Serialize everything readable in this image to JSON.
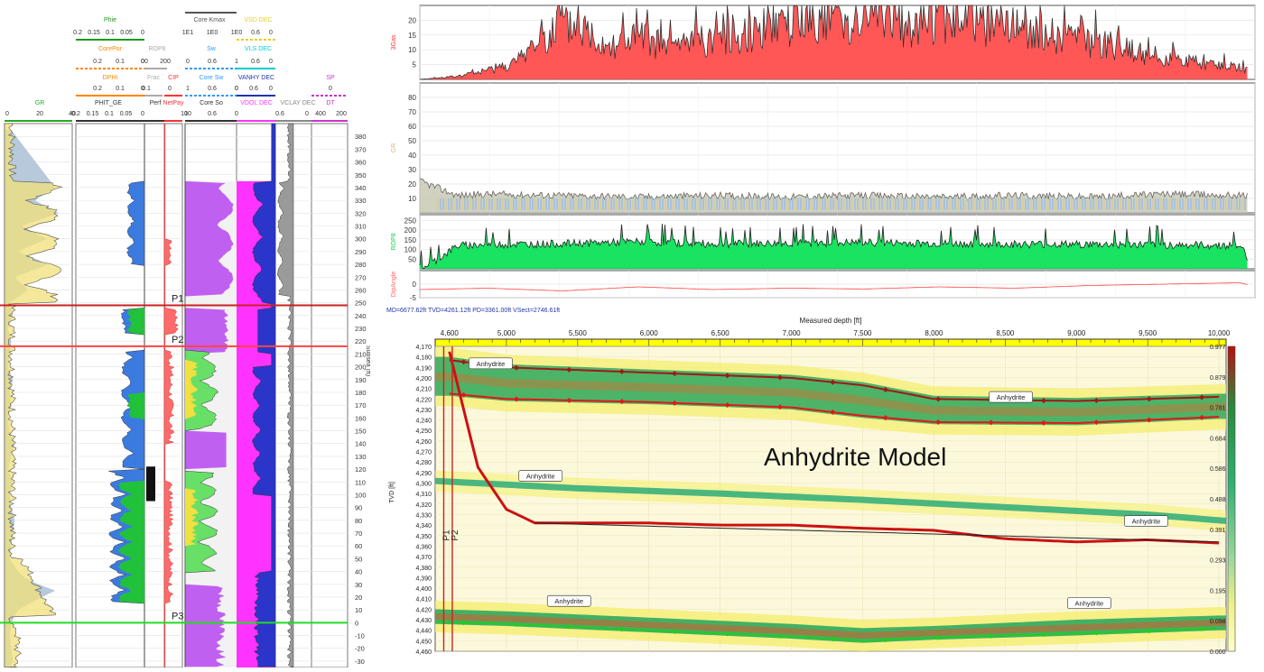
{
  "left_log": {
    "headers": {
      "phie": {
        "name": "Phie",
        "ticks": [
          "0.2",
          "0.15",
          "0.1",
          "0.05",
          "0"
        ],
        "color": "#1a9a1a"
      },
      "core_kmax": {
        "name": "Core Kmax",
        "ticks": [
          "1E1",
          "1E0",
          "1E0"
        ],
        "color": "#555555"
      },
      "vsd_dec": {
        "name": "VSD DEC",
        "ticks": [
          "0.6",
          "0"
        ],
        "color": "#e6d020"
      },
      "corepor": {
        "name": "CorePor",
        "ticks": [
          "0.2",
          "0.1",
          "0"
        ],
        "color": "#ff8800"
      },
      "rop": {
        "name": "ROP8",
        "ticks": [
          "00",
          "200"
        ],
        "color": "#aaaaaa"
      },
      "sw": {
        "name": "Sw",
        "ticks": [
          "0",
          "0.6",
          "1"
        ],
        "color": "#3399ff"
      },
      "vls_dec": {
        "name": "VLS DEC",
        "ticks": [
          "0.6",
          "0"
        ],
        "color": "#00cccc"
      },
      "dphi": {
        "name": "DPHI",
        "ticks": [
          "0.2",
          "0.1",
          "0"
        ],
        "color": "#ff8800"
      },
      "frac": {
        "name": "Frac",
        "ticks": [
          "0.1"
        ],
        "color": "#aaaaaa"
      },
      "cip": {
        "name": "CIP",
        "ticks": [
          "0"
        ],
        "color": "#ff3333"
      },
      "core_sw": {
        "name": "Core Sw",
        "ticks": [
          "1",
          "0.6",
          "0"
        ],
        "color": "#3399ff"
      },
      "vanhy_dec": {
        "name": "VANHY DEC",
        "ticks": [
          "0",
          "0.6",
          "0"
        ],
        "color": "#2233aa"
      },
      "sp": {
        "name": "SP",
        "ticks": [
          "0"
        ],
        "color": "#cc33cc"
      },
      "gr": {
        "name": "GR",
        "ticks": [
          "0",
          "20",
          "40"
        ],
        "color": "#22aa22"
      },
      "phit": {
        "name": "PHIT_GE",
        "ticks": [
          "0.2",
          "0.15",
          "0.1",
          "0.05",
          "0"
        ],
        "color": "#333333"
      },
      "perf": {
        "name": "Perf",
        "ticks": [],
        "color": "#333333"
      },
      "netpay": {
        "name": "NetPay",
        "ticks": [
          "10"
        ],
        "color": "#ff3333"
      },
      "core_so": {
        "name": "Core So",
        "ticks": [
          "10",
          "0.6",
          "0"
        ],
        "color": "#333333"
      },
      "vdol": {
        "name": "VDOL DEC",
        "color": "#ff33ff"
      },
      "vclay": {
        "name": "VCLAY DEC",
        "ticks": [
          "0.6",
          "0"
        ],
        "color": "#888888"
      },
      "dt": {
        "name": "DT",
        "ticks": [
          "400",
          "200"
        ],
        "color": "#cc33cc"
      }
    },
    "depth_axis_label": "Subsea (ft)",
    "markers": [
      {
        "label": "P1",
        "depth": 248,
        "color": "#cc2222"
      },
      {
        "label": "P2",
        "depth": 216,
        "color": "#ff4444"
      },
      {
        "label": "P3",
        "depth": 0,
        "color": "#22dd22"
      }
    ]
  },
  "chart_data": [
    {
      "type": "area",
      "title": "",
      "ylabel": "Subsea (ft)",
      "xlabel": "GR",
      "xlim": [
        0,
        40
      ],
      "ylim": [
        -35,
        390
      ],
      "depth_ticks": [
        380,
        370,
        360,
        350,
        340,
        330,
        320,
        310,
        300,
        290,
        280,
        270,
        260,
        250,
        240,
        230,
        220,
        210,
        200,
        190,
        180,
        170,
        160,
        150,
        140,
        130,
        120,
        110,
        100,
        90,
        80,
        70,
        60,
        50,
        40,
        30,
        20,
        10,
        0,
        -10,
        -20,
        -30
      ],
      "series": [
        {
          "name": "GR",
          "x": [
            4,
            30,
            18,
            32,
            10,
            25,
            8,
            26,
            6,
            14,
            3,
            5,
            2,
            4,
            3,
            2,
            5,
            3,
            4,
            2,
            3,
            6,
            4,
            2,
            5,
            3,
            4,
            6,
            5,
            4,
            3,
            8,
            12,
            20,
            30,
            22,
            8,
            4,
            3,
            4,
            5,
            3
          ],
          "y": [
            385,
            340,
            330,
            320,
            310,
            300,
            290,
            280,
            270,
            260,
            250,
            240,
            230,
            220,
            210,
            200,
            190,
            180,
            170,
            160,
            150,
            140,
            130,
            120,
            110,
            100,
            90,
            80,
            70,
            60,
            50,
            40,
            35,
            30,
            25,
            20,
            10,
            0,
            -10,
            -20,
            -30,
            -35
          ]
        }
      ]
    },
    {
      "type": "area",
      "title": "",
      "ylabel": "3Gas",
      "xlim": [
        4550,
        10100
      ],
      "ylim": [
        0,
        25
      ],
      "y_ticks": [
        20,
        15,
        10,
        5
      ],
      "series": [
        {
          "name": "3Gas",
          "x": [
            4550,
            4800,
            5000,
            5200,
            5400,
            5600,
            5800,
            6000,
            6200,
            6400,
            6600,
            6800,
            7000,
            7200,
            7400,
            7600,
            7800,
            8000,
            8200,
            8400,
            8600,
            8800,
            9000,
            9200,
            9400,
            9600,
            9800,
            10000,
            10050
          ],
          "y": [
            0,
            1,
            3,
            6,
            16,
            18,
            12,
            14,
            11,
            13,
            15,
            17,
            19,
            21,
            20,
            22,
            19,
            21,
            20,
            18,
            16,
            14,
            13,
            11,
            8,
            7,
            5,
            4,
            3
          ]
        }
      ]
    },
    {
      "type": "area",
      "title": "",
      "ylabel": "GR",
      "ylim": [
        0,
        90
      ],
      "y_ticks": [
        80,
        70,
        60,
        50,
        40,
        30,
        20,
        10
      ],
      "series": [
        {
          "name": "GR",
          "x": [
            4550,
            4800,
            5000,
            5500,
            6000,
            6500,
            7000,
            7500,
            8000,
            8500,
            9000,
            9500,
            10050
          ],
          "y": [
            22,
            12,
            13,
            12,
            11,
            12,
            11,
            12,
            11,
            12,
            11,
            13,
            12
          ]
        }
      ]
    },
    {
      "type": "area",
      "title": "",
      "ylabel": "ROP8",
      "ylim": [
        0,
        280
      ],
      "y_ticks": [
        250,
        200,
        150,
        100,
        50
      ],
      "series": [
        {
          "name": "ROP8",
          "x": [
            4550,
            4650,
            4800,
            5000,
            5500,
            6000,
            6500,
            7000,
            7500,
            8000,
            8500,
            9000,
            9500,
            10000,
            10050
          ],
          "y": [
            0,
            40,
            120,
            125,
            130,
            140,
            128,
            132,
            136,
            130,
            128,
            126,
            124,
            120,
            60
          ]
        }
      ]
    },
    {
      "type": "line",
      "title": "",
      "ylabel": "DipAngle",
      "ylim": [
        -5,
        5
      ],
      "y_ticks": [
        0,
        -5
      ],
      "series": [
        {
          "name": "DipAngle",
          "x": [
            4550,
            5000,
            5500,
            6000,
            6500,
            7000,
            7500,
            8000,
            8500,
            9000,
            9500,
            10000,
            10050
          ],
          "y": [
            -2,
            -1.5,
            -2.5,
            -1,
            -2,
            -1.5,
            -1.8,
            -1,
            -1.5,
            -0.5,
            0,
            0.5,
            -0.2
          ]
        }
      ]
    },
    {
      "type": "heatmap",
      "title": "Anhydrite Model",
      "xlabel": "Measured depth [ft]",
      "ylabel": "TVD [ft]",
      "xlim": [
        4500,
        10050
      ],
      "ylim": [
        4460,
        4170
      ],
      "x_ticks": [
        4600,
        5000,
        5500,
        6000,
        6500,
        7000,
        7500,
        8000,
        8500,
        9000,
        9500,
        10000
      ],
      "y_ticks": [
        4170,
        4180,
        4190,
        4200,
        4210,
        4220,
        4230,
        4240,
        4250,
        4260,
        4270,
        4280,
        4290,
        4300,
        4310,
        4320,
        4330,
        4340,
        4350,
        4360,
        4370,
        4380,
        4390,
        4400,
        4410,
        4420,
        4430,
        4440,
        4450,
        4460
      ],
      "colorbar_ticks": [
        "0.977",
        "0.879",
        "0.781",
        "0.684",
        "0.586",
        "0.488",
        "0.391",
        "0.293",
        "0.195",
        "0.098",
        "0.000"
      ],
      "series": [
        {
          "name": "upper-anhydrite-top",
          "x": [
            4600,
            5000,
            6000,
            7000,
            7500,
            8000,
            9000,
            10000
          ],
          "y": [
            4183,
            4190,
            4195,
            4200,
            4207,
            4220,
            4222,
            4218
          ]
        },
        {
          "name": "upper-anhydrite-base",
          "x": [
            4600,
            5000,
            6000,
            7000,
            7500,
            8000,
            9000,
            10000
          ],
          "y": [
            4215,
            4220,
            4223,
            4228,
            4236,
            4242,
            4243,
            4237
          ]
        },
        {
          "name": "mid-anhydrite",
          "x": [
            4500,
            5500,
            6500,
            7500,
            8500,
            9500,
            10050
          ],
          "y": [
            4298,
            4305,
            4310,
            4316,
            4323,
            4330,
            4336
          ]
        },
        {
          "name": "wellbore",
          "x": [
            4600,
            4700,
            4800,
            5000,
            5200,
            5500,
            6000,
            6500,
            7000,
            7500,
            8000,
            8500,
            9000,
            9500,
            10000
          ],
          "y": [
            4175,
            4230,
            4285,
            4325,
            4338,
            4338,
            4338,
            4340,
            4340,
            4343,
            4345,
            4353,
            4356,
            4354,
            4357
          ]
        },
        {
          "name": "lower-anhydrite-top",
          "x": [
            4500,
            5000,
            6000,
            7000,
            7500,
            8000,
            9000,
            10000
          ],
          "y": [
            4422,
            4424,
            4430,
            4436,
            4440,
            4438,
            4432,
            4428
          ]
        },
        {
          "name": "lower-anhydrite-base",
          "x": [
            4500,
            5000,
            6000,
            7000,
            7500,
            8000,
            9000,
            10000
          ],
          "y": [
            4432,
            4434,
            4440,
            4446,
            4450,
            4447,
            4443,
            4438
          ]
        }
      ],
      "labels": [
        {
          "text": "Anhydrite",
          "x": 4750,
          "y": 4187
        },
        {
          "text": "Anhydrite",
          "x": 8400,
          "y": 4219
        },
        {
          "text": "Anhydrite",
          "x": 5100,
          "y": 4294
        },
        {
          "text": "Anhydrite",
          "x": 9350,
          "y": 4337
        },
        {
          "text": "Anhydrite",
          "x": 5300,
          "y": 4413
        },
        {
          "text": "Anhydrite",
          "x": 8950,
          "y": 4415
        }
      ],
      "well_markers": [
        {
          "label": "P1",
          "x": 4560
        },
        {
          "label": "P2",
          "x": 4620
        }
      ]
    }
  ],
  "model_info": "MD=6677.62ft TVD=4261.12ft PD=3361.00ft VSect=2746.61ft"
}
